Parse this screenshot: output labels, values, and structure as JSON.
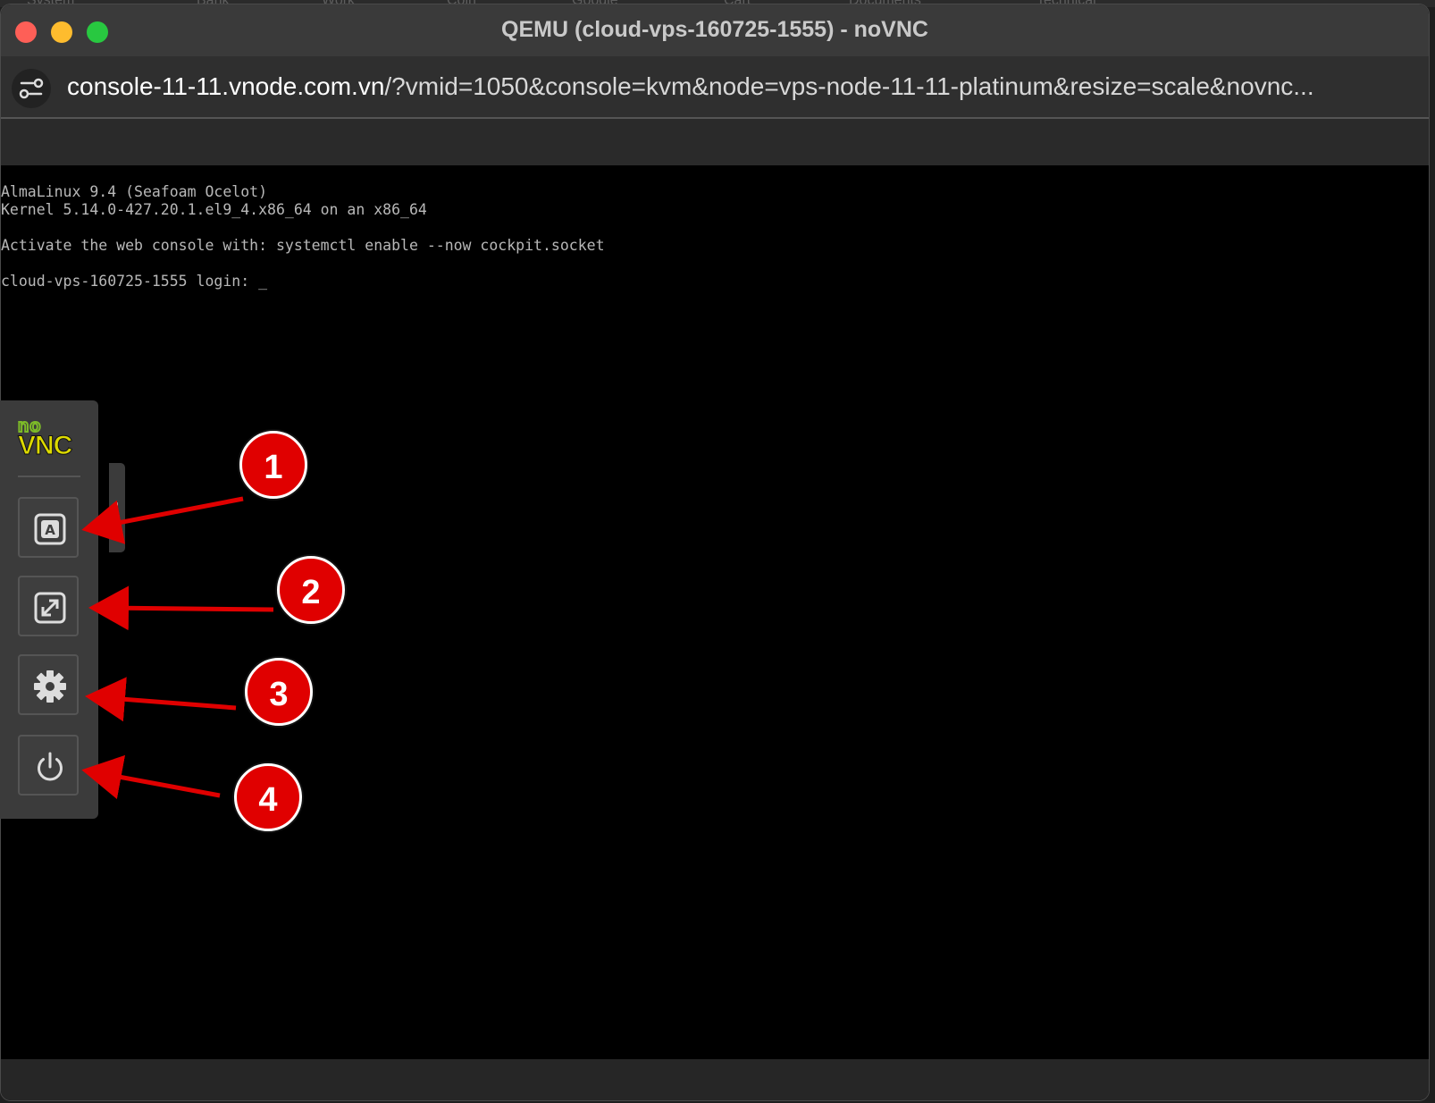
{
  "bookmarks": [
    "System",
    "Bank",
    "Work",
    "Coin",
    "Google",
    "Cart",
    "Documents",
    "Technical"
  ],
  "window": {
    "title": "QEMU (cloud-vps-160725-1555) - noVNC"
  },
  "address_bar": {
    "host": "console-11-11.vnode.com.vn",
    "path": "/?vmid=1050&console=kvm&node=vps-node-11-11-platinum&resize=scale&novnc..."
  },
  "terminal": {
    "lines": [
      "AlmaLinux 9.4 (Seafoam Ocelot)",
      "Kernel 5.14.0-427.20.1.el9_4.x86_64 on an x86_64",
      "Activate the web console with: systemctl enable --now cockpit.socket",
      "cloud-vps-160725-1555 login: "
    ],
    "cursor": "_"
  },
  "novnc": {
    "logo_top": "no",
    "logo_bottom": "VNC",
    "buttons": [
      {
        "icon": "keyboard-icon"
      },
      {
        "icon": "fullscreen-icon"
      },
      {
        "icon": "gear-icon"
      },
      {
        "icon": "power-icon"
      }
    ]
  },
  "annotations": {
    "callouts": [
      "1",
      "2",
      "3",
      "4"
    ],
    "color": "#e00000"
  },
  "colors": {
    "close": "#fe5f57",
    "minimize": "#febc2e",
    "maximize": "#28c840",
    "logo_yellow": "#ddda00",
    "logo_green": "#7dbb28"
  }
}
